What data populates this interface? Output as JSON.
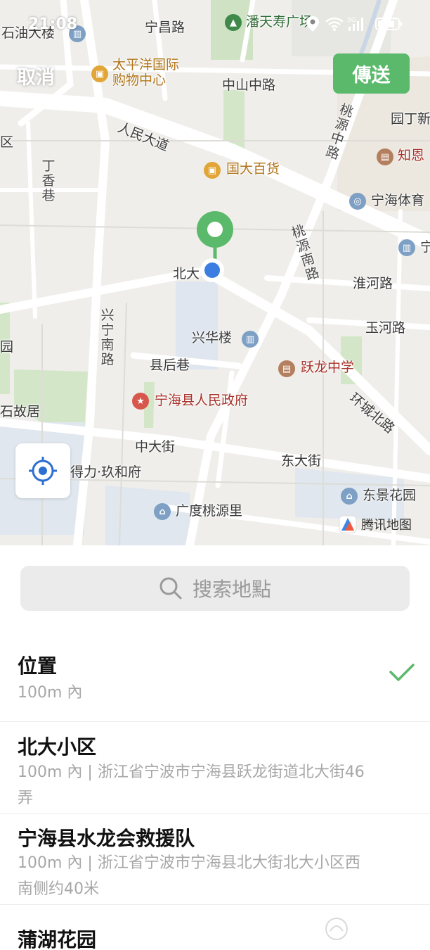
{
  "status_bar": {
    "time": "21:08"
  },
  "header": {
    "cancel_label": "取消",
    "send_label": "傳送"
  },
  "map": {
    "labels": {
      "shiyou": "石油大楼",
      "ningchang": "宁昌路",
      "pantianshou": "潘天寿广场",
      "taipingyang": "太平洋国际",
      "taipingyang2": "购物中心",
      "zhongshan": "中山中路",
      "yuanding": "园丁新",
      "renmin": "人民大道",
      "taoyuanzhong": "桃源中路",
      "zhien": "知恩",
      "dingxiang": "丁香巷",
      "guoda": "国大百货",
      "ninghai_ty": "宁海体育",
      "beida": "北大",
      "taoyuannan": "桃源南路",
      "huaihe": "淮河路",
      "xingning": "兴宁南路",
      "xinghua": "兴华楼",
      "yuhe": "玉河路",
      "xianhou": "县后巷",
      "yuelong": "跃龙中学",
      "zhengfu": "宁海县人民政府",
      "huancheng": "环城北路",
      "guju": "石故居",
      "zhongda": "中大街",
      "dongda": "东大街",
      "deli": "得力·玖和府",
      "dongjing": "东景花园",
      "guangdu": "广度桃源里",
      "left_qu": "区",
      "right_ning": "宁",
      "left_edge": "园"
    },
    "brand": "腾讯地图"
  },
  "search": {
    "placeholder": "搜索地點"
  },
  "results": [
    {
      "title": "位置",
      "subtitle": "100m 內",
      "selected": true
    },
    {
      "title": "北大小区",
      "subtitle": "100m 內 | 浙江省宁波市宁海县跃龙街道北大街46弄",
      "selected": false
    },
    {
      "title": "宁海县水龙会救援队",
      "subtitle": "100m 內 | 浙江省宁波市宁海县北大街北大小区西南侧约40米",
      "selected": false
    },
    {
      "title": "蒲湖花园",
      "subtitle": "",
      "selected": false
    }
  ],
  "colors": {
    "accent": "#5bb96b",
    "pin": "#5bb96b",
    "location_dot": "#3b7de0"
  }
}
